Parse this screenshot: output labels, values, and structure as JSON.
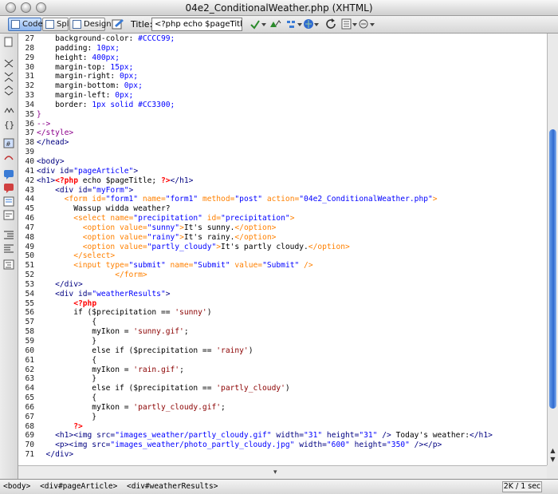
{
  "window": {
    "title": "04e2_ConditionalWeather.php (XHTML)"
  },
  "toolbar": {
    "view_buttons": [
      {
        "label": "Code",
        "active": true
      },
      {
        "label": "Split",
        "active": false
      },
      {
        "label": "Design",
        "active": false
      }
    ],
    "title_label": "Title:",
    "title_value": "<?php echo $pageTitle; ?>"
  },
  "colors": {
    "text": "#000000",
    "tag": "#000080",
    "form_tag": "#FF8000",
    "attr_value": "#0000FF",
    "php_delim": "#FF0000",
    "php_string": "#8B0000",
    "css_value": "#0000FF",
    "comment": "#8B008B"
  },
  "editor": {
    "first_line_number": 27,
    "lines": [
      [
        [
          "    background-color: ",
          "text"
        ],
        [
          "#CCCC99;",
          "css_value"
        ]
      ],
      [
        [
          "    padding: ",
          "text"
        ],
        [
          "10px;",
          "css_value"
        ]
      ],
      [
        [
          "    height: ",
          "text"
        ],
        [
          "400px;",
          "css_value"
        ]
      ],
      [
        [
          "    margin-top: ",
          "text"
        ],
        [
          "15px;",
          "css_value"
        ]
      ],
      [
        [
          "    margin-right: ",
          "text"
        ],
        [
          "0px;",
          "css_value"
        ]
      ],
      [
        [
          "    margin-bottom: ",
          "text"
        ],
        [
          "0px;",
          "css_value"
        ]
      ],
      [
        [
          "    margin-left: ",
          "text"
        ],
        [
          "0px;",
          "css_value"
        ]
      ],
      [
        [
          "    border: ",
          "text"
        ],
        [
          "1px solid #CC3300;",
          "css_value"
        ]
      ],
      [
        [
          "}",
          "comment"
        ]
      ],
      [
        [
          "-->",
          "comment"
        ]
      ],
      [
        [
          "</style>",
          "comment"
        ]
      ],
      [
        [
          "</head>",
          "tag"
        ]
      ],
      [
        [
          "",
          "text"
        ]
      ],
      [
        [
          "<body>",
          "tag"
        ]
      ],
      [
        [
          "<div id=",
          "tag"
        ],
        [
          "\"pageArticle\"",
          "attr_value"
        ],
        [
          ">",
          "tag"
        ]
      ],
      [
        [
          "<h1>",
          "tag"
        ],
        [
          "<?php",
          "php_delim"
        ],
        [
          " echo $pageTitle; ",
          "text"
        ],
        [
          "?>",
          "php_delim"
        ],
        [
          "</h1>",
          "tag"
        ]
      ],
      [
        [
          "    <div id=",
          "tag"
        ],
        [
          "\"myForm\"",
          "attr_value"
        ],
        [
          ">",
          "tag"
        ]
      ],
      [
        [
          "      <form id=",
          "form_tag"
        ],
        [
          "\"form1\"",
          "attr_value"
        ],
        [
          " name=",
          "form_tag"
        ],
        [
          "\"form1\"",
          "attr_value"
        ],
        [
          " method=",
          "form_tag"
        ],
        [
          "\"post\"",
          "attr_value"
        ],
        [
          " action=",
          "form_tag"
        ],
        [
          "\"04e2_ConditionalWeather.php\"",
          "attr_value"
        ],
        [
          ">",
          "form_tag"
        ]
      ],
      [
        [
          "        Wassup widda weather?",
          "text"
        ]
      ],
      [
        [
          "        <select name=",
          "form_tag"
        ],
        [
          "\"precipitation\"",
          "attr_value"
        ],
        [
          " id=",
          "form_tag"
        ],
        [
          "\"precipitation\"",
          "attr_value"
        ],
        [
          ">",
          "form_tag"
        ]
      ],
      [
        [
          "          <option value=",
          "form_tag"
        ],
        [
          "\"sunny\"",
          "attr_value"
        ],
        [
          ">",
          "form_tag"
        ],
        [
          "It's sunny.",
          "text"
        ],
        [
          "</option>",
          "form_tag"
        ]
      ],
      [
        [
          "          <option value=",
          "form_tag"
        ],
        [
          "\"rainy\"",
          "attr_value"
        ],
        [
          ">",
          "form_tag"
        ],
        [
          "It's rainy.",
          "text"
        ],
        [
          "</option>",
          "form_tag"
        ]
      ],
      [
        [
          "          <option value=",
          "form_tag"
        ],
        [
          "\"partly_cloudy\"",
          "attr_value"
        ],
        [
          ">",
          "form_tag"
        ],
        [
          "It's partly cloudy.",
          "text"
        ],
        [
          "</option>",
          "form_tag"
        ]
      ],
      [
        [
          "        </select>",
          "form_tag"
        ]
      ],
      [
        [
          "        <input type=",
          "form_tag"
        ],
        [
          "\"submit\"",
          "attr_value"
        ],
        [
          " name=",
          "form_tag"
        ],
        [
          "\"Submit\"",
          "attr_value"
        ],
        [
          " value=",
          "form_tag"
        ],
        [
          "\"Submit\"",
          "attr_value"
        ],
        [
          " />",
          "form_tag"
        ]
      ],
      [
        [
          "                 </form>",
          "form_tag"
        ]
      ],
      [
        [
          "    </div>",
          "tag"
        ]
      ],
      [
        [
          "    <div id=",
          "tag"
        ],
        [
          "\"weatherResults\"",
          "attr_value"
        ],
        [
          ">",
          "tag"
        ]
      ],
      [
        [
          "        ",
          "text"
        ],
        [
          "<?php",
          "php_delim"
        ]
      ],
      [
        [
          "        if ($precipitation == ",
          "text"
        ],
        [
          "'sunny'",
          "php_string"
        ],
        [
          ")",
          "text"
        ]
      ],
      [
        [
          "            {",
          "text"
        ]
      ],
      [
        [
          "            myIkon = ",
          "text"
        ],
        [
          "'sunny.gif'",
          "php_string"
        ],
        [
          ";",
          "text"
        ]
      ],
      [
        [
          "            }",
          "text"
        ]
      ],
      [
        [
          "            else if ($precipitation == ",
          "text"
        ],
        [
          "'rainy'",
          "php_string"
        ],
        [
          ")",
          "text"
        ]
      ],
      [
        [
          "            {",
          "text"
        ]
      ],
      [
        [
          "            myIkon = ",
          "text"
        ],
        [
          "'rain.gif'",
          "php_string"
        ],
        [
          ";",
          "text"
        ]
      ],
      [
        [
          "            }",
          "text"
        ]
      ],
      [
        [
          "            else if ($precipitation == ",
          "text"
        ],
        [
          "'partly_cloudy'",
          "php_string"
        ],
        [
          ")",
          "text"
        ]
      ],
      [
        [
          "            {",
          "text"
        ]
      ],
      [
        [
          "            myIkon = ",
          "text"
        ],
        [
          "'partly_cloudy.gif'",
          "php_string"
        ],
        [
          ";",
          "text"
        ]
      ],
      [
        [
          "            }",
          "text"
        ]
      ],
      [
        [
          "        ",
          "text"
        ],
        [
          "?>",
          "php_delim"
        ]
      ],
      [
        [
          "    <h1><img src=",
          "tag"
        ],
        [
          "\"images_weather/partly_cloudy.gif\"",
          "attr_value"
        ],
        [
          " width=",
          "tag"
        ],
        [
          "\"31\"",
          "attr_value"
        ],
        [
          " height=",
          "tag"
        ],
        [
          "\"31\"",
          "attr_value"
        ],
        [
          " />",
          "tag"
        ],
        [
          " Today's weather:",
          "text"
        ],
        [
          "</h1>",
          "tag"
        ]
      ],
      [
        [
          "    <p><img src=",
          "tag"
        ],
        [
          "\"images_weather/photo_partly_cloudy.jpg\"",
          "attr_value"
        ],
        [
          " width=",
          "tag"
        ],
        [
          "\"600\"",
          "attr_value"
        ],
        [
          " height=",
          "tag"
        ],
        [
          "\"350\"",
          "attr_value"
        ],
        [
          " /></p>",
          "tag"
        ]
      ],
      [
        [
          "  </div>",
          "tag"
        ]
      ]
    ]
  },
  "status": {
    "tag_selector": [
      "<body>",
      "<div#pageArticle>",
      "<div#weatherResults>"
    ],
    "file_info": "2K / 1 sec"
  },
  "scroll": {
    "vertical_position": 0.74
  }
}
